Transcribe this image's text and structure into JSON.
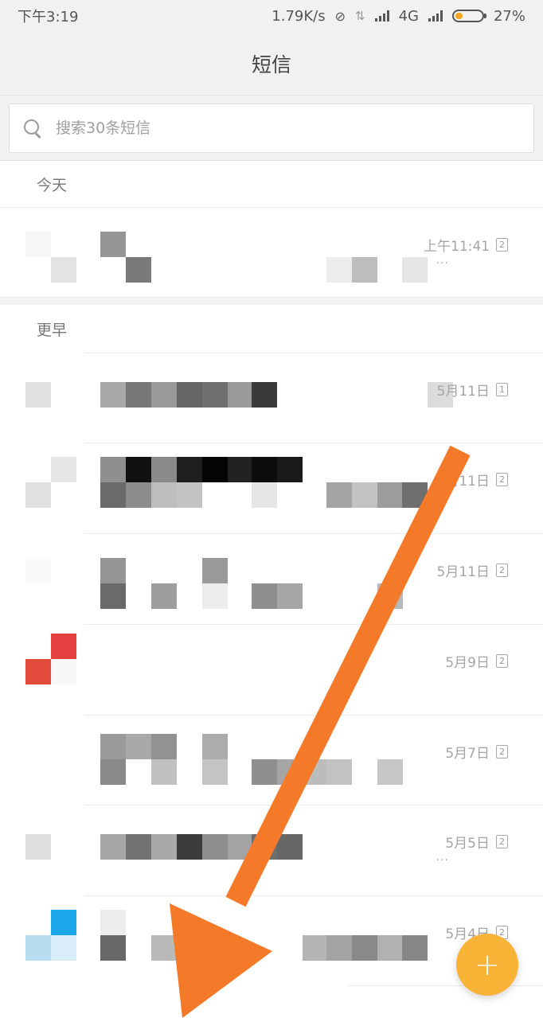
{
  "status_bar": {
    "time": "下午3:19",
    "net_speed": "1.79K/s",
    "network": "4G",
    "battery": "27%",
    "battery_level": 0.27
  },
  "header": {
    "title": "短信"
  },
  "search": {
    "placeholder": "搜索30条短信"
  },
  "sections": {
    "today": "今天",
    "earlier": "更早"
  },
  "messages": [
    {
      "time": "上午11:41",
      "sim": "2"
    },
    {
      "time": "5月11日",
      "sim": "1"
    },
    {
      "time": "5月11日",
      "sim": "2"
    },
    {
      "time": "5月11日",
      "sim": "2"
    },
    {
      "time": "5月9日",
      "sim": "2"
    },
    {
      "time": "5月7日",
      "sim": "2"
    },
    {
      "time": "5月5日",
      "sim": "2"
    },
    {
      "time": "5月4日",
      "sim": "2"
    }
  ],
  "fab": {
    "icon": "plus-icon"
  },
  "colors": {
    "accent": "#f8b236",
    "arrow": "#f47a2a",
    "avatar_red": "#e54040",
    "avatar_blue": "#1aa6e8"
  }
}
